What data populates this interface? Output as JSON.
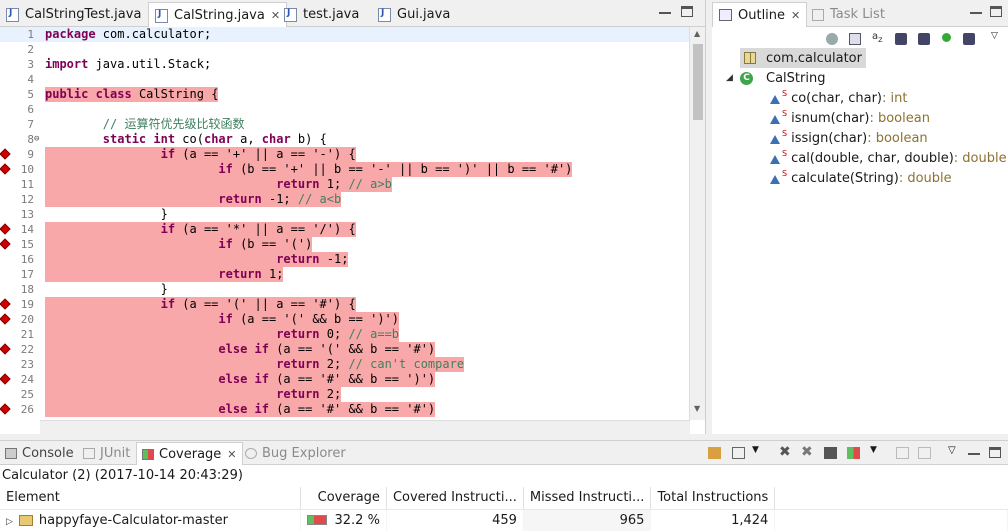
{
  "editor_tabs": [
    {
      "label": "CalStringTest.java",
      "active": false
    },
    {
      "label": "CalString.java",
      "active": true,
      "close": "✕"
    },
    {
      "label": "test.java",
      "active": false
    },
    {
      "label": "Gui.java",
      "active": false
    }
  ],
  "code_lines": [
    {
      "n": "1",
      "text": "package com.calculator;",
      "hl": false,
      "marker": false,
      "fold": ""
    },
    {
      "n": "2",
      "text": "",
      "hl": false,
      "marker": false,
      "fold": ""
    },
    {
      "n": "3",
      "text": "import java.util.Stack;",
      "hl": false,
      "marker": false,
      "fold": ""
    },
    {
      "n": "4",
      "text": "",
      "hl": false,
      "marker": false,
      "fold": ""
    },
    {
      "n": "5",
      "text": "public class CalString {",
      "hl": true,
      "marker": false,
      "fold": ""
    },
    {
      "n": "6",
      "text": "",
      "hl": false,
      "marker": false,
      "fold": ""
    },
    {
      "n": "7",
      "text": "        // 运算符优先级比较函数",
      "hl": false,
      "marker": false,
      "fold": ""
    },
    {
      "n": "8",
      "text": "        static int co(char a, char b) {",
      "hl": false,
      "marker": false,
      "fold": "⊖"
    },
    {
      "n": "9",
      "text": "                if (a == '+' || a == '-') {",
      "hl": true,
      "marker": true,
      "fold": ""
    },
    {
      "n": "10",
      "text": "                        if (b == '+' || b == '-' || b == ')' || b == '#')",
      "hl": true,
      "marker": true,
      "fold": ""
    },
    {
      "n": "11",
      "text": "                                return 1; // a>b",
      "hl": true,
      "marker": false,
      "fold": ""
    },
    {
      "n": "12",
      "text": "                        return -1; // a<b",
      "hl": true,
      "marker": false,
      "fold": ""
    },
    {
      "n": "13",
      "text": "                }",
      "hl": false,
      "marker": false,
      "fold": ""
    },
    {
      "n": "14",
      "text": "                if (a == '*' || a == '/') {",
      "hl": true,
      "marker": true,
      "fold": ""
    },
    {
      "n": "15",
      "text": "                        if (b == '(')",
      "hl": true,
      "marker": true,
      "fold": ""
    },
    {
      "n": "16",
      "text": "                                return -1;",
      "hl": true,
      "marker": false,
      "fold": ""
    },
    {
      "n": "17",
      "text": "                        return 1;",
      "hl": true,
      "marker": false,
      "fold": ""
    },
    {
      "n": "18",
      "text": "                }",
      "hl": false,
      "marker": false,
      "fold": ""
    },
    {
      "n": "19",
      "text": "                if (a == '(' || a == '#') {",
      "hl": true,
      "marker": true,
      "fold": ""
    },
    {
      "n": "20",
      "text": "                        if (a == '(' && b == ')')",
      "hl": true,
      "marker": true,
      "fold": ""
    },
    {
      "n": "21",
      "text": "                                return 0; // a==b",
      "hl": true,
      "marker": false,
      "fold": ""
    },
    {
      "n": "22",
      "text": "                        else if (a == '(' && b == '#')",
      "hl": true,
      "marker": true,
      "fold": ""
    },
    {
      "n": "23",
      "text": "                                return 2; // can't compare",
      "hl": true,
      "marker": false,
      "fold": ""
    },
    {
      "n": "24",
      "text": "                        else if (a == '#' && b == ')')",
      "hl": true,
      "marker": true,
      "fold": ""
    },
    {
      "n": "25",
      "text": "                                return 2;",
      "hl": true,
      "marker": false,
      "fold": ""
    },
    {
      "n": "26",
      "text": "                        else if (a == '#' && b == '#')",
      "hl": true,
      "marker": true,
      "fold": ""
    }
  ],
  "outline": {
    "tab_label": "Outline",
    "tab_close": "✕",
    "task_tab_label": "Task List",
    "package": "com.calculator",
    "class_name": "CalString",
    "class_icon_letter": "C",
    "static_mark": "S",
    "methods": [
      {
        "sig": "co(char, char)",
        "rtype": " : int"
      },
      {
        "sig": "isnum(char)",
        "rtype": " : boolean"
      },
      {
        "sig": "issign(char)",
        "rtype": " : boolean"
      },
      {
        "sig": "cal(double, char, double)",
        "rtype": " : double"
      },
      {
        "sig": "calculate(String)",
        "rtype": " : double"
      }
    ]
  },
  "bottom": {
    "tabs": [
      {
        "label": "Console",
        "active": false
      },
      {
        "label": "JUnit",
        "active": false
      },
      {
        "label": "Coverage",
        "active": true,
        "close": "✕"
      },
      {
        "label": "Bug Explorer",
        "active": false
      }
    ],
    "session": "Calculator (2) (2017-10-14 20:43:29)",
    "columns": [
      "Element",
      "Coverage",
      "Covered Instructi...",
      "Missed Instructi...",
      "Total Instructions"
    ],
    "rows": [
      {
        "element": "happyfaye-Calculator-master",
        "coverage": "32.2 %",
        "coverage_fraction": 0.322,
        "covered": "459",
        "missed": "965",
        "total": "1,424"
      }
    ]
  },
  "colors": {
    "uncovered_highlight": "#f8a8a8",
    "coverage_green": "#5fbf5f",
    "coverage_red": "#e04a4a"
  }
}
